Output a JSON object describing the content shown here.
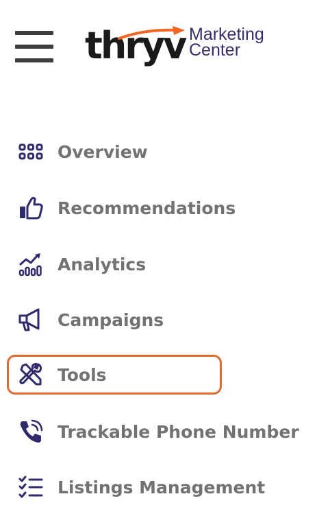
{
  "header": {
    "menu_icon": "hamburger-menu-icon",
    "logo": {
      "wordmark": "thryv",
      "subtitle_line1": "Marketing",
      "subtitle_line2": "Center"
    }
  },
  "nav": {
    "items": [
      {
        "label": "Overview",
        "icon": "grid-dots-icon"
      },
      {
        "label": "Recommendations",
        "icon": "thumbs-up-icon"
      },
      {
        "label": "Analytics",
        "icon": "analytics-chart-icon"
      },
      {
        "label": "Campaigns",
        "icon": "megaphone-icon"
      },
      {
        "label": "Tools",
        "icon": "tools-icon",
        "highlighted": true
      },
      {
        "label": "Trackable Phone Number",
        "icon": "phone-ring-icon"
      },
      {
        "label": "Listings Management",
        "icon": "checklist-icon"
      }
    ]
  },
  "colors": {
    "icon": "#2e2a6b",
    "label": "#727272",
    "highlight_border": "#e06a2f",
    "brand_orange": "#f26522",
    "brand_purple": "#3b2d6b"
  }
}
